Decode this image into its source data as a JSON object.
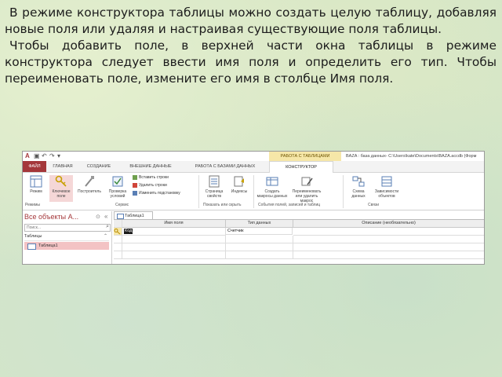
{
  "slide": {
    "paragraph1": "В режиме конструктора таблицы можно создать целую таблицу, добавляя новые поля или удаляя и настраивая существующие поля таблицы.",
    "paragraph2": "Чтобы добавить поле, в верхней части окна таблицы в режиме конструктора следует ввести имя поля и определить его тип. Чтобы переименовать поле, измените его имя в столбце Имя поля."
  },
  "access": {
    "titlebar": {
      "context_group": "РАБОТА С ТАБЛИЦАМИ",
      "title": "BAZA : база данных- C:\\Users\\kate\\Documents\\BAZA.accdb (Форм"
    },
    "tabs": [
      "ФАЙЛ",
      "ГЛАВНАЯ",
      "СОЗДАНИЕ",
      "ВНЕШНИЕ ДАННЫЕ",
      "РАБОТА С БАЗАМИ ДАННЫХ",
      "КОНСТРУКТОР"
    ],
    "ribbon": {
      "view": "Режим",
      "key_field": "Ключевое поле",
      "builder": "Построитель",
      "test_rules": "Проверка условий",
      "insert_rows": "Вставить строки",
      "delete_rows": "Удалить строки",
      "change_lookup": "Изменить подстановку",
      "property_sheet": "Страница свойств",
      "indexes": "Индексы",
      "create_macros": "Создать макросы данных",
      "rename_delete_macro": "Переименовать или удалить макрос",
      "relationships": "Схема данных",
      "dependencies": "Зависимости объектов",
      "group_views": "Режимы",
      "group_tools": "Сервис",
      "group_show_hide": "Показать или скрыть",
      "group_events": "События полей, записей и таблиц",
      "group_relationships": "Связи"
    },
    "nav": {
      "title": "Все объекты А...",
      "search_placeholder": "Поиск...",
      "section": "Таблицы",
      "item": "Таблица1"
    },
    "document": {
      "tab": "Таблица1",
      "columns": [
        "Имя поля",
        "Тип данных",
        "Описание (необязательно)"
      ],
      "rows": [
        {
          "name": "Код",
          "type": "Счетчик",
          "desc": ""
        }
      ]
    }
  }
}
